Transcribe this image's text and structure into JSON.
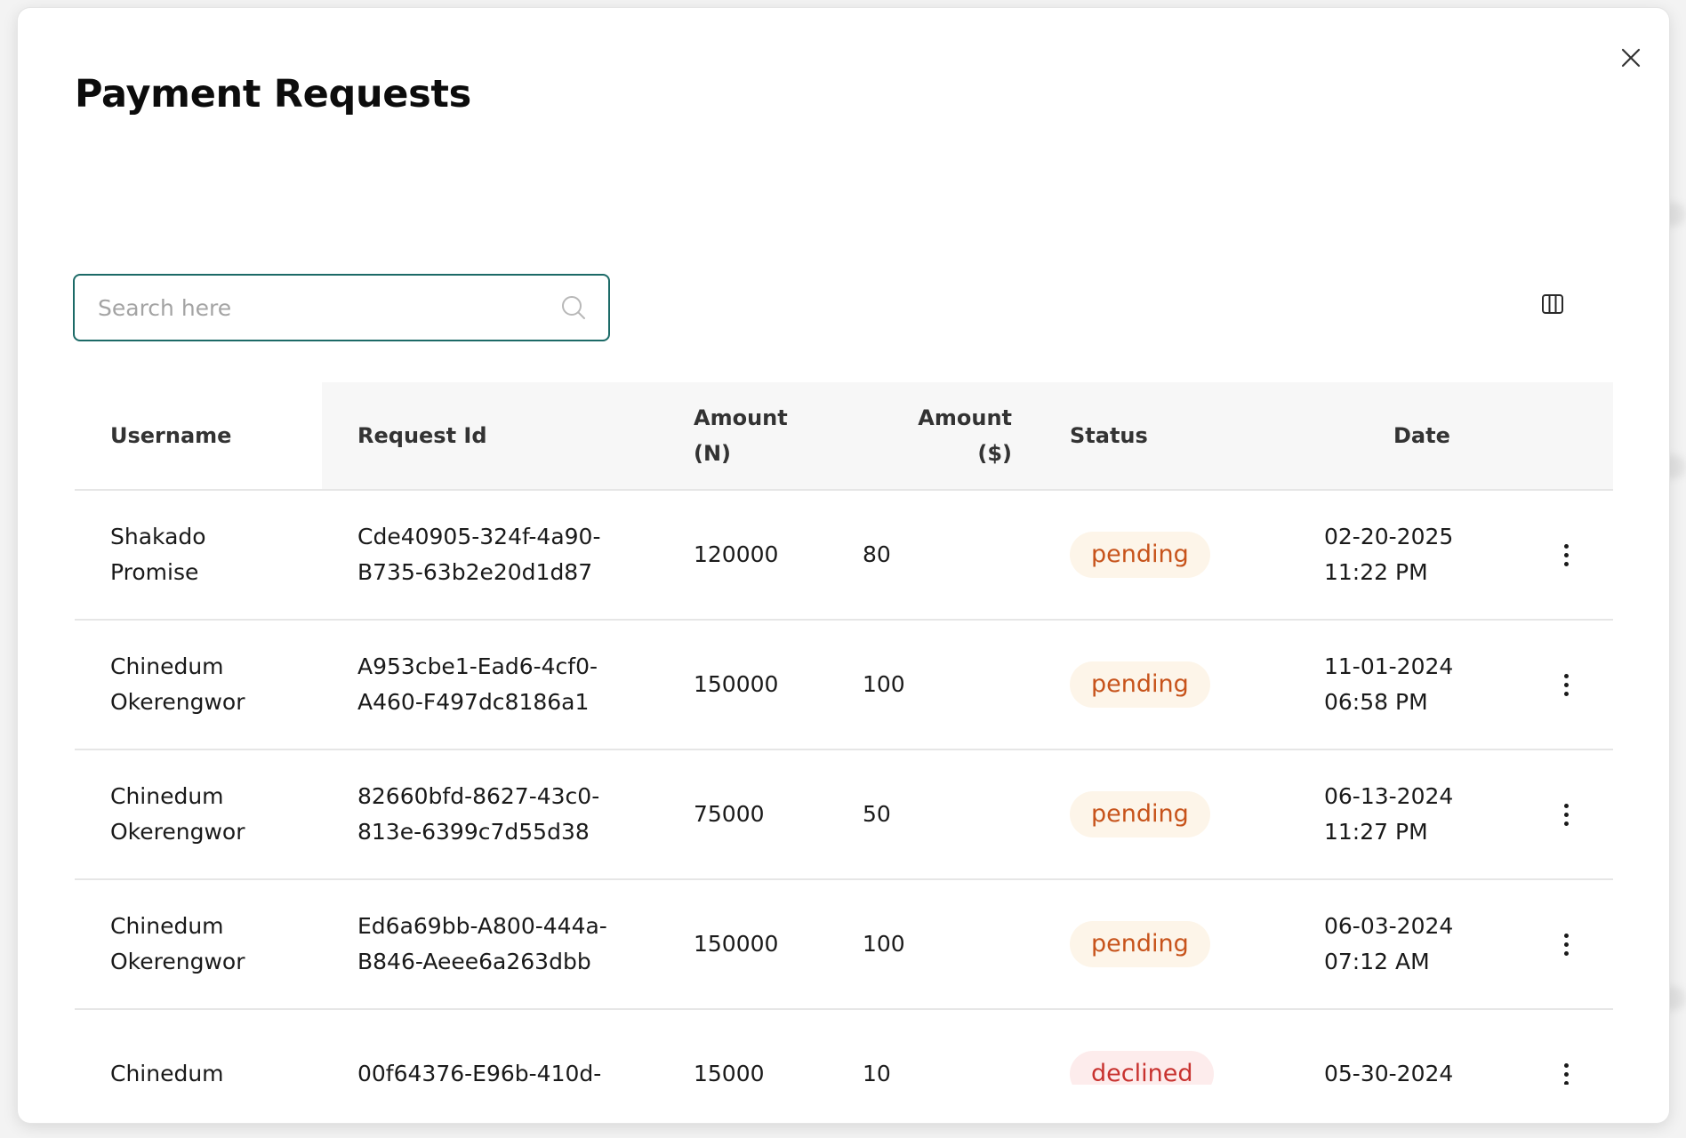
{
  "modal": {
    "title": "Payment Requests"
  },
  "search": {
    "placeholder": "Search here"
  },
  "table": {
    "headers": {
      "username": "Username",
      "request_id": "Request Id",
      "amount_n_line1": "Amount",
      "amount_n_line2": "(N)",
      "amount_usd_line1": "Amount",
      "amount_usd_line2": "($)",
      "status": "Status",
      "date": "Date"
    },
    "rows": [
      {
        "username": [
          "Shakado",
          "Promise"
        ],
        "request_id": [
          "Cde40905-324f-4a90-",
          "B735-63b2e20d1d87"
        ],
        "amount_n": "120000",
        "amount_usd": "80",
        "status": "pending",
        "date": [
          "02-20-2025",
          "11:22 PM"
        ]
      },
      {
        "username": [
          "Chinedum",
          "Okerengwor"
        ],
        "request_id": [
          "A953cbe1-Ead6-4cf0-",
          "A460-F497dc8186a1"
        ],
        "amount_n": "150000",
        "amount_usd": "100",
        "status": "pending",
        "date": [
          "11-01-2024",
          "06:58 PM"
        ]
      },
      {
        "username": [
          "Chinedum",
          "Okerengwor"
        ],
        "request_id": [
          "82660bfd-8627-43c0-",
          "813e-6399c7d55d38"
        ],
        "amount_n": "75000",
        "amount_usd": "50",
        "status": "pending",
        "date": [
          "06-13-2024",
          "11:27 PM"
        ]
      },
      {
        "username": [
          "Chinedum",
          "Okerengwor"
        ],
        "request_id": [
          "Ed6a69bb-A800-444a-",
          "B846-Aeee6a263dbb"
        ],
        "amount_n": "150000",
        "amount_usd": "100",
        "status": "pending",
        "date": [
          "06-03-2024",
          "07:12 AM"
        ]
      },
      {
        "username": [
          "Chinedum",
          ""
        ],
        "request_id": [
          "00f64376-E96b-410d-",
          ""
        ],
        "amount_n": "15000",
        "amount_usd": "10",
        "status": "declined",
        "date": [
          "05-30-2024",
          ""
        ]
      }
    ]
  },
  "icons": {
    "close": "close-icon",
    "search": "search-icon",
    "columns": "columns-icon",
    "row_menu": "more-vertical-icon"
  },
  "colors": {
    "accent_border": "#1c6a67",
    "pending_text": "#c7531b",
    "pending_bg": "#fdf5e9",
    "declined_text": "#c8322f",
    "declined_bg": "#fdecec"
  }
}
